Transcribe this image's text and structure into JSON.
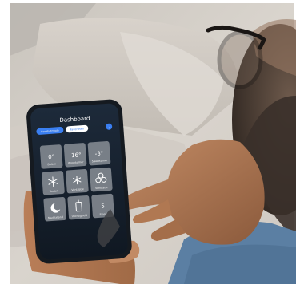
{
  "photo": {
    "subject": "person-using-smartphone-app",
    "colors": {
      "accent": "#3a7ff2",
      "tile": "#e9e9ea",
      "sweater": "#5b7fa3"
    }
  },
  "phone_screen": {
    "title": "Dashboard",
    "tabs": [
      "Comfortmode",
      "Favorieten"
    ],
    "tiles": [
      {
        "value": "0°",
        "label": "Buiten"
      },
      {
        "value": "-16°",
        "label": "Woonkamer"
      },
      {
        "value": "-3°",
        "label": "Slaapkamer"
      },
      {
        "icon": "snowflake-icon",
        "label": "Koelen"
      },
      {
        "icon": "fan-icon",
        "label": "Ventilatie"
      },
      {
        "icon": "fan-icon",
        "label": "Ventilator"
      },
      {
        "icon": "moon-icon",
        "label": "Nachtstand"
      },
      {
        "icon": "bottle-icon",
        "label": "Vochtigheid"
      },
      {
        "value": "5",
        "label": "Stand"
      }
    ]
  }
}
